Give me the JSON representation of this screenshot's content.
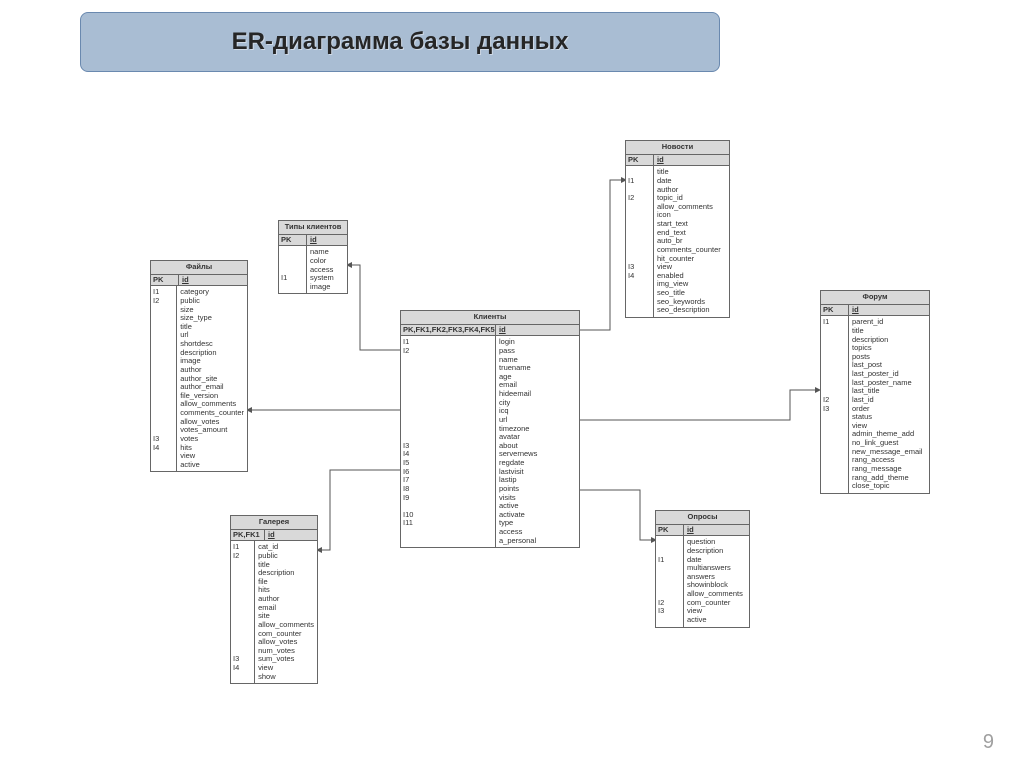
{
  "title": "ER-диаграмма базы данных",
  "page_number": "9",
  "entities": {
    "files": {
      "title": "Файлы",
      "head_k": "PK",
      "head_n": "id",
      "keys": [
        "I1",
        "I2",
        "",
        "",
        "",
        "",
        "",
        "",
        "",
        "",
        "",
        "",
        "",
        "",
        "",
        "",
        "",
        "I3",
        "I4",
        ""
      ],
      "fields": [
        "category",
        "public",
        "size",
        "size_type",
        "title",
        "url",
        "shortdesc",
        "description",
        "image",
        "author",
        "author_site",
        "author_email",
        "file_version",
        "allow_comments",
        "comments_counter",
        "allow_votes",
        "votes_amount",
        "votes",
        "hits",
        "view",
        "active"
      ]
    },
    "client_types": {
      "title": "Типы клиентов",
      "head_k": "PK",
      "head_n": "id",
      "keys": [
        "",
        "",
        "",
        "I1",
        ""
      ],
      "fields": [
        "name",
        "color",
        "access",
        "system",
        "image"
      ]
    },
    "clients": {
      "title": "Клиенты",
      "head_k": "PK,FK1,FK2,FK3,FK4,FK5",
      "head_n": "id",
      "keys": [
        "I1",
        "I2",
        "",
        "",
        "",
        "",
        "",
        "",
        "",
        "",
        "",
        "",
        "I3",
        "I4",
        "I5",
        "I6",
        "I7",
        "I8",
        "I9",
        "",
        "I10",
        "I11",
        ""
      ],
      "fields": [
        "login",
        "pass",
        "name",
        "truename",
        "age",
        "email",
        "hideemail",
        "city",
        "icq",
        "url",
        "timezone",
        "avatar",
        "about",
        "servernews",
        "regdate",
        "lastvisit",
        "lastip",
        "points",
        "visits",
        "active",
        "activate",
        "type",
        "access",
        "a_personal"
      ]
    },
    "news": {
      "title": "Новости",
      "head_k": "PK",
      "head_n": "id",
      "keys": [
        "",
        "I1",
        "",
        "I2",
        "",
        "",
        "",
        "",
        "",
        "",
        "",
        "I3",
        "I4",
        "",
        "",
        "",
        ""
      ],
      "fields": [
        "title",
        "date",
        "author",
        "topic_id",
        "allow_comments",
        "icon",
        "start_text",
        "end_text",
        "auto_br",
        "comments_counter",
        "hit_counter",
        "view",
        "enabled",
        "img_view",
        "seo_title",
        "seo_keywords",
        "seo_description"
      ]
    },
    "gallery": {
      "title": "Галерея",
      "head_k": "PK,FK1",
      "head_n": "id",
      "keys": [
        "I1",
        "I2",
        "",
        "",
        "",
        "",
        "",
        "",
        "",
        "",
        "",
        "",
        "",
        "I3",
        "I4",
        ""
      ],
      "fields": [
        "cat_id",
        "public",
        "title",
        "description",
        "file",
        "hits",
        "author",
        "email",
        "site",
        "allow_comments",
        "com_counter",
        "allow_votes",
        "num_votes",
        "sum_votes",
        "view",
        "show"
      ]
    },
    "polls": {
      "title": "Опросы",
      "head_k": "PK",
      "head_n": "id",
      "keys": [
        "",
        "",
        "I1",
        "",
        "",
        "",
        "",
        "I2",
        "I3",
        ""
      ],
      "fields": [
        "question",
        "description",
        "date",
        "multianswers",
        "answers",
        "showinblock",
        "allow_comments",
        "com_counter",
        "view",
        "active"
      ]
    },
    "forum": {
      "title": "Форум",
      "head_k": "PK",
      "head_n": "id",
      "keys": [
        "I1",
        "",
        "",
        "",
        "",
        "",
        "",
        "",
        "",
        "I2",
        "I3",
        "",
        "",
        "",
        "",
        "",
        "",
        "",
        ""
      ],
      "fields": [
        "parent_id",
        "title",
        "description",
        "topics",
        "posts",
        "last_post",
        "last_poster_id",
        "last_poster_name",
        "last_title",
        "last_id",
        "order",
        "status",
        "view",
        "admin_theme_add",
        "no_link_guest",
        "new_message_email",
        "rang_access",
        "rang_message",
        "rang_add_theme",
        "close_topic"
      ]
    }
  }
}
